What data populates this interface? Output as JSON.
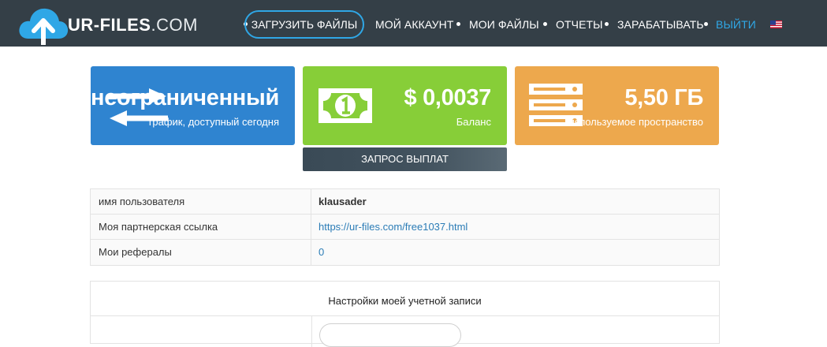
{
  "brand": {
    "name_bold": "UR-FILES",
    "name_light": ".COM"
  },
  "nav": {
    "upload": "ЗАГРУЗИТЬ ФАЙЛЫ",
    "account": "МОЙ АККАУНТ",
    "files": "МОИ ФАЙЛЫ",
    "reports": "ОТЧЕТЫ",
    "earn": "ЗАРАБАТЫВАТЬ",
    "logout": "ВЫЙТИ",
    "language_icon": "us-flag-icon"
  },
  "cards": {
    "traffic": {
      "value": "неограниченный",
      "label": "трафик, доступный сегодня",
      "color": "#2f84d0",
      "icon": "transfer-arrows-icon"
    },
    "balance": {
      "value": "$ 0,0037",
      "label": "Баланс",
      "color": "#87ce38",
      "icon": "banknote-icon"
    },
    "storage": {
      "value": "5,50 ГБ",
      "label": "используемое пространство",
      "color": "#eda84d",
      "icon": "server-icon"
    }
  },
  "payout_button": "ЗАПРОС ВЫПЛАТ",
  "info": {
    "rows": [
      {
        "key": "имя пользователя",
        "value": "klausader"
      },
      {
        "key": "Моя партнерская ссылка",
        "value": "https://ur-files.com/free1037.html"
      },
      {
        "key": "Мои рефералы",
        "value": "0"
      }
    ]
  },
  "settings": {
    "title": "Настройки моей учетной записи"
  },
  "colors": {
    "navbar": "#343f47",
    "accent": "#2fa7e6",
    "link": "#2b7cb6"
  }
}
